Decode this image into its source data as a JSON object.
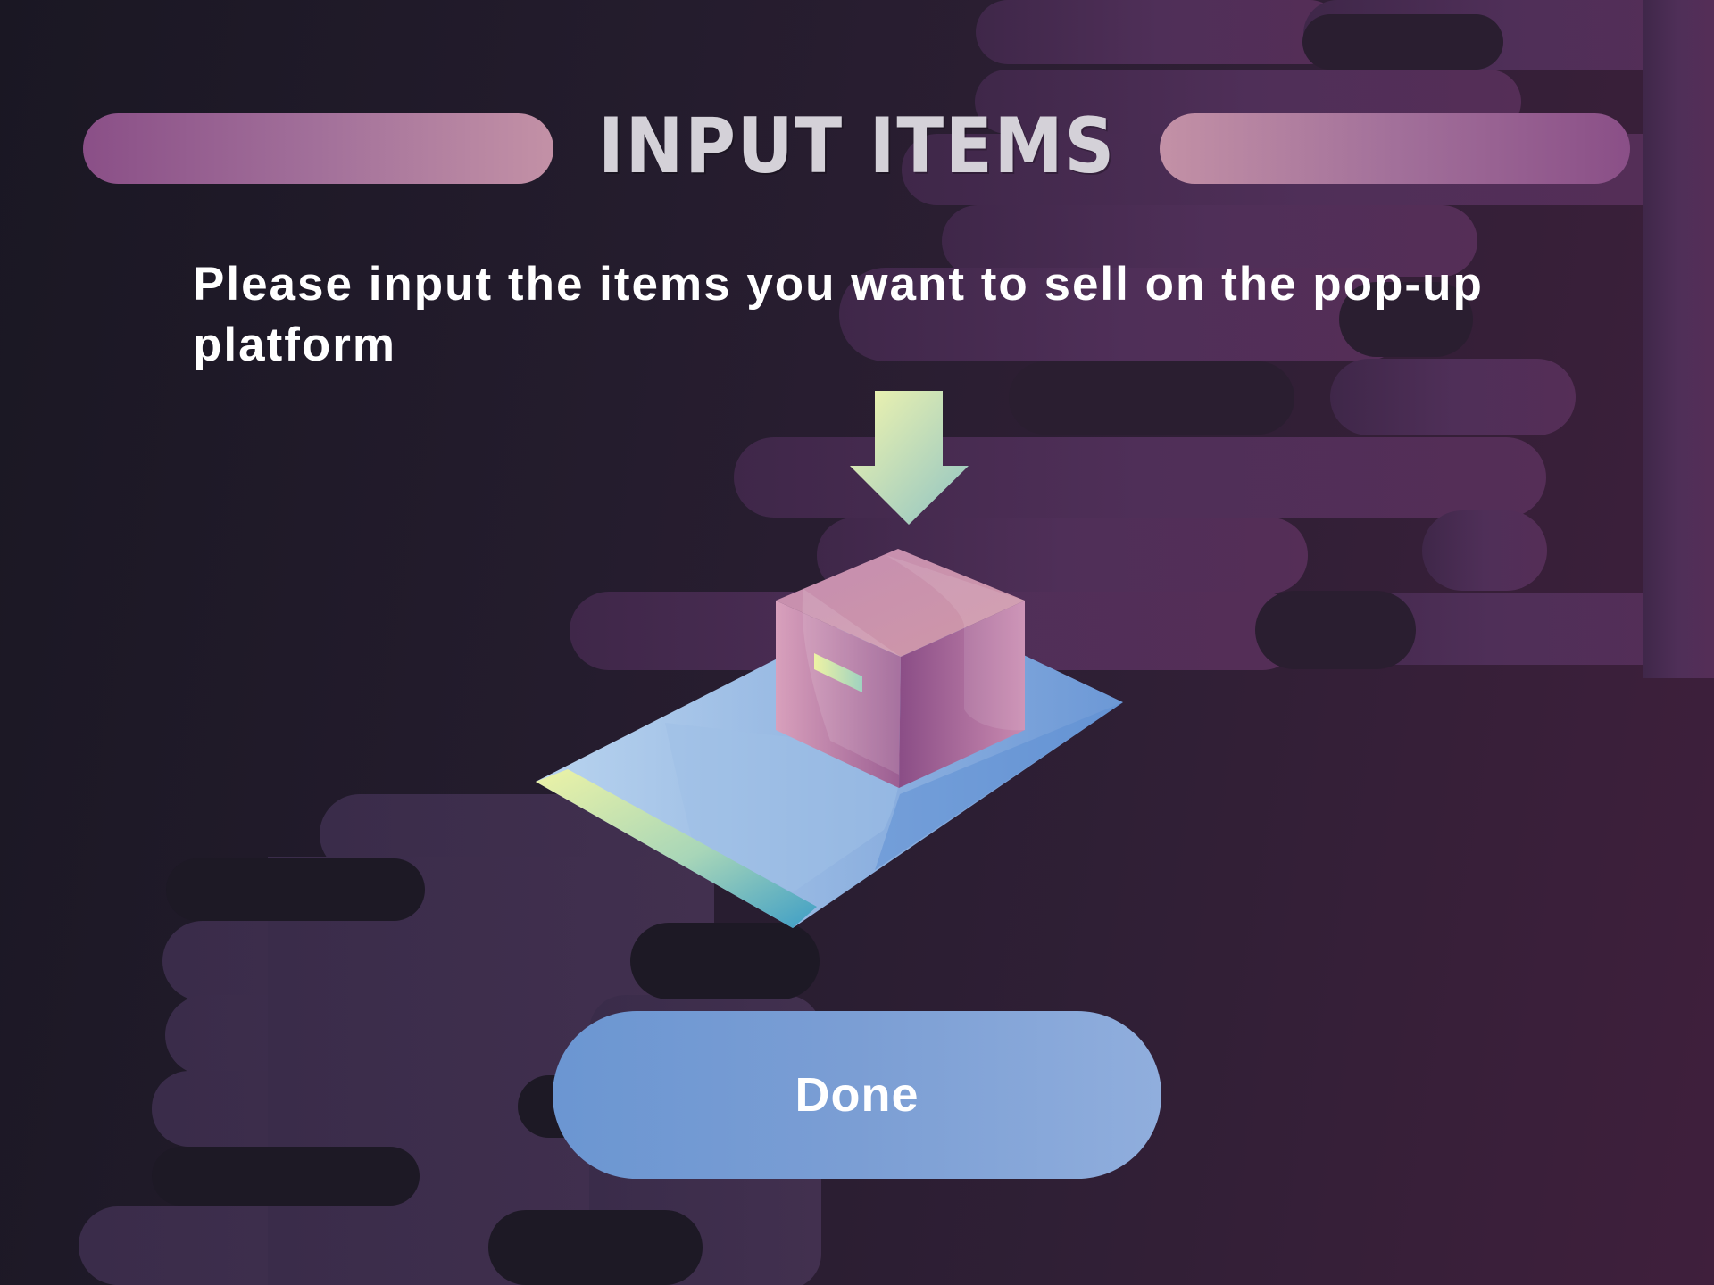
{
  "screen": {
    "title": "INPUT ITEMS",
    "instruction": "Please input the items you want to sell on the pop-up platform"
  },
  "done_button": {
    "label": "Done"
  },
  "illustration": {
    "arrow_icon": "down-arrow-icon",
    "box_icon": "item-box-icon",
    "platform_icon": "popup-platform-icon"
  },
  "colors": {
    "background": "#1b1824",
    "cloud": "#4a2c55",
    "title_bar": "#a2709a",
    "title_text": "#d4d1d8",
    "button": "#7b9ed4",
    "box": "#b77ea6",
    "platform": "#8db4e3",
    "arrow": "#e8f2a8"
  }
}
